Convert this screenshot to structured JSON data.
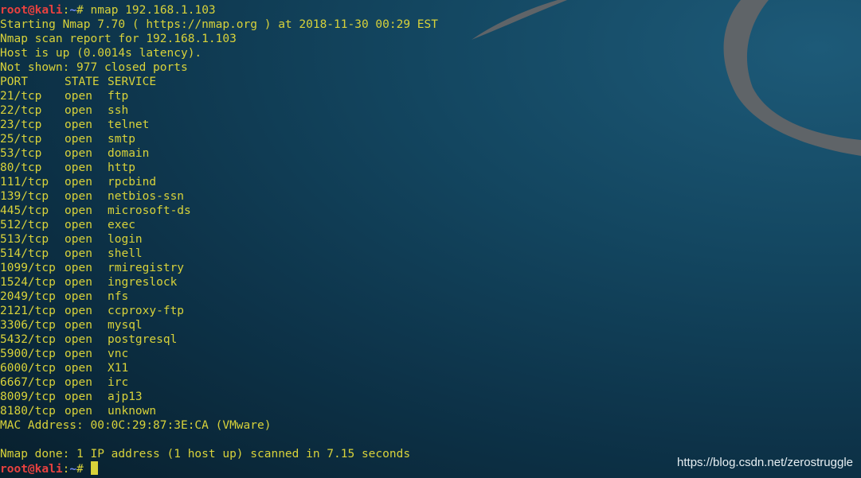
{
  "prompt": {
    "user_host": "root@kali",
    "separator": ":",
    "path": "~",
    "symbol": "# "
  },
  "command": "nmap 192.168.1.103",
  "header_lines": [
    "Starting Nmap 7.70 ( https://nmap.org ) at 2018-11-30 00:29 EST",
    "Nmap scan report for 192.168.1.103",
    "Host is up (0.0014s latency).",
    "Not shown: 977 closed ports"
  ],
  "table_header": {
    "port": "PORT",
    "state": "STATE",
    "service": "SERVICE"
  },
  "ports": [
    {
      "port": "21/tcp",
      "state": "open",
      "service": "ftp"
    },
    {
      "port": "22/tcp",
      "state": "open",
      "service": "ssh"
    },
    {
      "port": "23/tcp",
      "state": "open",
      "service": "telnet"
    },
    {
      "port": "25/tcp",
      "state": "open",
      "service": "smtp"
    },
    {
      "port": "53/tcp",
      "state": "open",
      "service": "domain"
    },
    {
      "port": "80/tcp",
      "state": "open",
      "service": "http"
    },
    {
      "port": "111/tcp",
      "state": "open",
      "service": "rpcbind"
    },
    {
      "port": "139/tcp",
      "state": "open",
      "service": "netbios-ssn"
    },
    {
      "port": "445/tcp",
      "state": "open",
      "service": "microsoft-ds"
    },
    {
      "port": "512/tcp",
      "state": "open",
      "service": "exec"
    },
    {
      "port": "513/tcp",
      "state": "open",
      "service": "login"
    },
    {
      "port": "514/tcp",
      "state": "open",
      "service": "shell"
    },
    {
      "port": "1099/tcp",
      "state": "open",
      "service": "rmiregistry"
    },
    {
      "port": "1524/tcp",
      "state": "open",
      "service": "ingreslock"
    },
    {
      "port": "2049/tcp",
      "state": "open",
      "service": "nfs"
    },
    {
      "port": "2121/tcp",
      "state": "open",
      "service": "ccproxy-ftp"
    },
    {
      "port": "3306/tcp",
      "state": "open",
      "service": "mysql"
    },
    {
      "port": "5432/tcp",
      "state": "open",
      "service": "postgresql"
    },
    {
      "port": "5900/tcp",
      "state": "open",
      "service": "vnc"
    },
    {
      "port": "6000/tcp",
      "state": "open",
      "service": "X11"
    },
    {
      "port": "6667/tcp",
      "state": "open",
      "service": "irc"
    },
    {
      "port": "8009/tcp",
      "state": "open",
      "service": "ajp13"
    },
    {
      "port": "8180/tcp",
      "state": "open",
      "service": "unknown"
    }
  ],
  "mac_line": "MAC Address: 00:0C:29:87:3E:CA (VMware)",
  "done_line": "Nmap done: 1 IP address (1 host up) scanned in 7.15 seconds",
  "watermark": "https://blog.csdn.net/zerostruggle",
  "colors": {
    "terminal_text": "#d8d23a",
    "prompt_user": "#e8413f",
    "prompt_path": "#6f8bf0",
    "background": "#0d3349",
    "dragon_logo": "#5f6468"
  }
}
